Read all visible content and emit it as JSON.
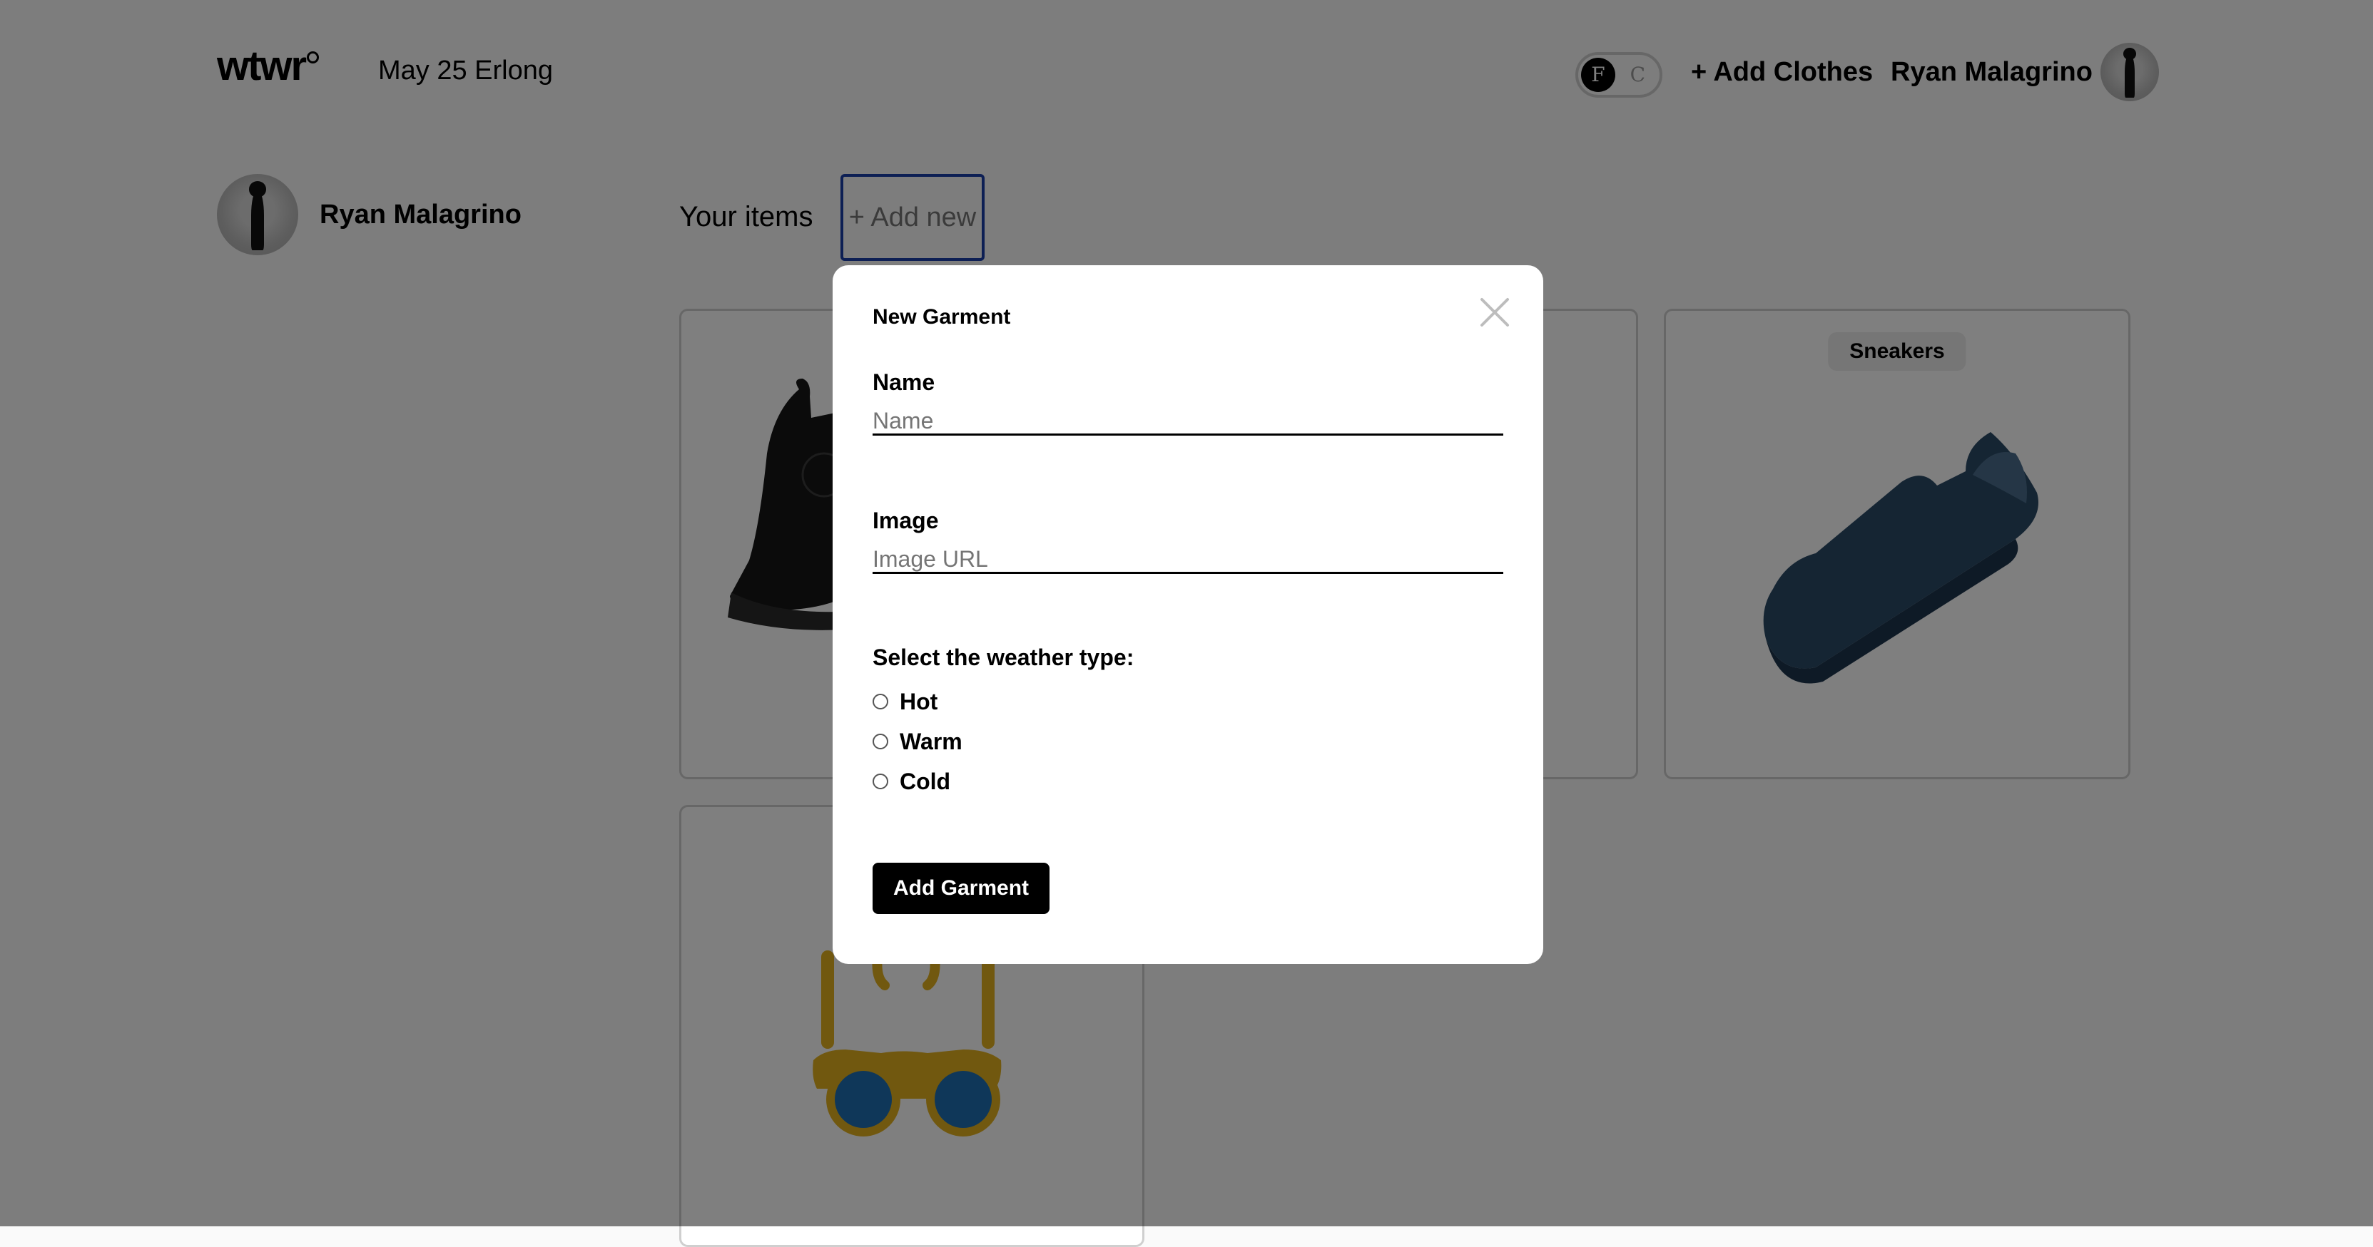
{
  "header": {
    "logo": "wtwr",
    "date_location": "May 25 Erlong",
    "temp_toggle": {
      "active": "F",
      "inactive": "C"
    },
    "add_clothes": "+ Add Clothes",
    "user_name": "Ryan Malagrino"
  },
  "sidebar": {
    "user_name": "Ryan Malagrino"
  },
  "items_section": {
    "title": "Your items",
    "add_new": "+ Add new",
    "cards": [
      {
        "name": "",
        "icon": "boot-icon"
      },
      {
        "name": "",
        "icon": "yellow-garment-icon"
      },
      {
        "name": "Sneakers",
        "icon": "sneaker-icon"
      },
      {
        "name": "",
        "icon": "sunglasses-icon"
      }
    ]
  },
  "modal": {
    "title": "New Garment",
    "name_label": "Name",
    "name_placeholder": "Name",
    "image_label": "Image",
    "image_placeholder": "Image URL",
    "weather_label": "Select the weather type:",
    "weather_options": [
      "Hot",
      "Warm",
      "Cold"
    ],
    "submit": "Add Garment"
  },
  "colors": {
    "overlay": "rgba(0,0,0,0.5)",
    "add_new_border": "#1a3ea8",
    "button_bg": "#000000"
  }
}
